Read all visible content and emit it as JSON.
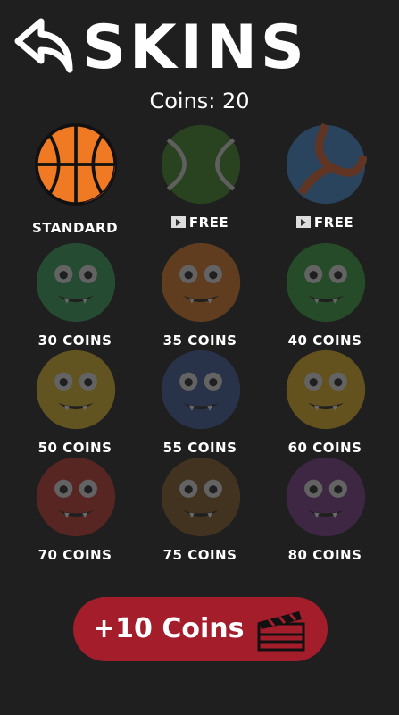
{
  "header": {
    "title": "SKINS",
    "back_icon": "back-arrow-icon"
  },
  "coins_label": "Coins: 20",
  "skins": [
    {
      "name": "standard",
      "label": "STANDARD",
      "color": "#f07a24",
      "locked": false,
      "type": "basketball"
    },
    {
      "name": "tennis",
      "label": "FREE",
      "color": "#3f8e25",
      "locked": true,
      "type": "tennis",
      "video": true
    },
    {
      "name": "volleyball",
      "label": "FREE",
      "color": "#3f8fd8",
      "locked": true,
      "type": "volley",
      "video": true
    },
    {
      "name": "green-face",
      "label": "30 COINS",
      "color": "#34a65a",
      "locked": true,
      "type": "monster"
    },
    {
      "name": "lion",
      "label": "35 COINS",
      "color": "#e37a1e",
      "locked": true,
      "type": "monster"
    },
    {
      "name": "alien",
      "label": "40 COINS",
      "color": "#34a43c",
      "locked": true,
      "type": "monster"
    },
    {
      "name": "blue-monster",
      "label": "50 COINS",
      "color": "#e9c126",
      "locked": true,
      "type": "monster"
    },
    {
      "name": "bat",
      "label": "55 COINS",
      "color": "#3b5b9c",
      "locked": true,
      "type": "monster"
    },
    {
      "name": "yellow-monster",
      "label": "60 COINS",
      "color": "#efbb1c",
      "locked": true,
      "type": "monster"
    },
    {
      "name": "red-monster",
      "label": "70 COINS",
      "color": "#c8322a",
      "locked": true,
      "type": "monster"
    },
    {
      "name": "brown-monster",
      "label": "75 COINS",
      "color": "#8a5c28",
      "locked": true,
      "type": "monster"
    },
    {
      "name": "purple-monster",
      "label": "80 COINS",
      "color": "#7a3a8c",
      "locked": true,
      "type": "monster"
    }
  ],
  "ad_button": {
    "label": "+10 Coins",
    "icon": "clapperboard-icon"
  }
}
